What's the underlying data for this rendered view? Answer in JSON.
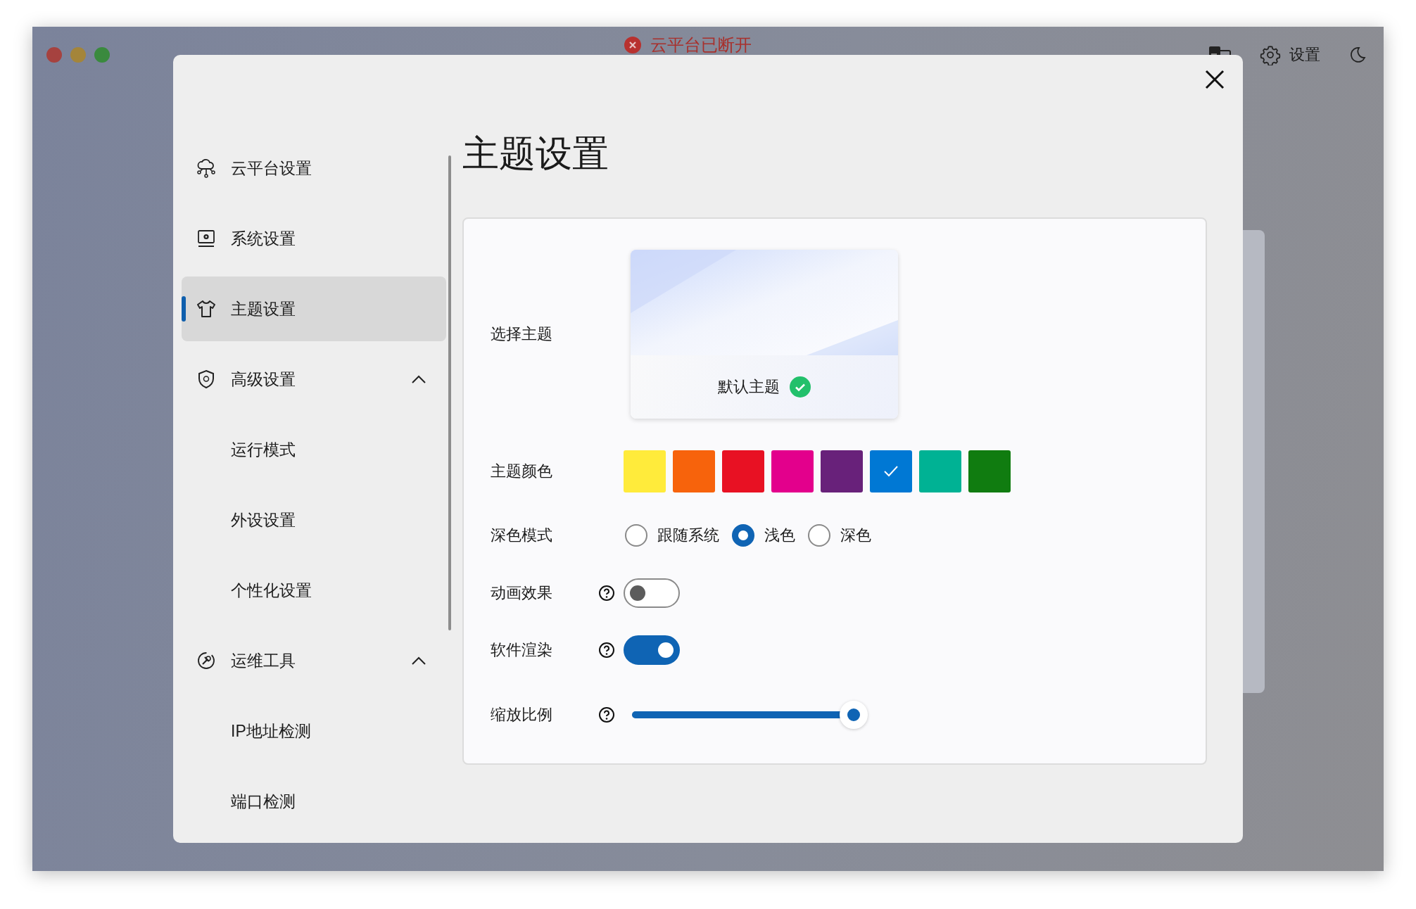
{
  "title_bar": {
    "status": "云平台已断开",
    "settings_label": "设置"
  },
  "dialog": {
    "title": "主题设置"
  },
  "sidebar": {
    "items": [
      {
        "label": "云平台设置",
        "selected": false
      },
      {
        "label": "系统设置",
        "selected": false
      },
      {
        "label": "主题设置",
        "selected": true
      },
      {
        "label": "高级设置",
        "selected": false,
        "expanded": true,
        "children": [
          {
            "label": "运行模式",
            "selected": false
          },
          {
            "label": "外设设置",
            "selected": false
          },
          {
            "label": "个性化设置",
            "selected": false
          }
        ]
      },
      {
        "label": "运维工具",
        "selected": false,
        "expanded": true,
        "children": [
          {
            "label": "IP地址检测",
            "selected": false
          },
          {
            "label": "端口检测",
            "selected": false
          }
        ]
      }
    ]
  },
  "theme_picker": {
    "label": "选择主题",
    "themes": [
      {
        "name": "默认主题",
        "selected": true
      }
    ]
  },
  "theme_color": {
    "label": "主题颜色",
    "colors": [
      {
        "color": "#ffeb3b",
        "selected": false
      },
      {
        "color": "#f7630c",
        "selected": false
      },
      {
        "color": "#e81123",
        "selected": false
      },
      {
        "color": "#e3008c",
        "selected": false
      },
      {
        "color": "#68217a",
        "selected": false
      },
      {
        "color": "#0078d4",
        "selected": true
      },
      {
        "color": "#00b294",
        "selected": false
      },
      {
        "color": "#107c10",
        "selected": false
      }
    ]
  },
  "dark_mode": {
    "label": "深色模式",
    "options": [
      {
        "label": "跟随系统",
        "selected": false
      },
      {
        "label": "浅色",
        "selected": true
      },
      {
        "label": "深色",
        "selected": false
      }
    ]
  },
  "options": [
    {
      "kind": "toggle",
      "label": "动画效果",
      "on": false
    },
    {
      "kind": "toggle",
      "label": "软件渲染",
      "on": true
    },
    {
      "kind": "slider",
      "label": "缩放比例",
      "level": 1
    }
  ]
}
